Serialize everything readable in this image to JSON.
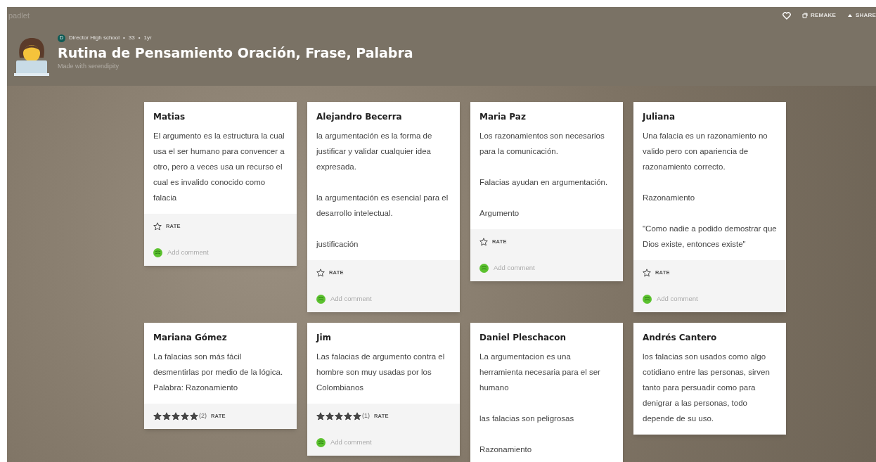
{
  "header": {
    "logo": "padlet",
    "author": {
      "initial": "D",
      "name": "Director High school",
      "separator_1": "•",
      "count": "33",
      "separator_2": "•",
      "age": "1yr"
    },
    "title": "Rutina de Pensamiento Oración, Frase, Palabra",
    "subtitle": "Made with serendipity",
    "actions": [
      "REMAKE",
      "SHARE"
    ]
  },
  "cards": [
    {
      "name": "Matias",
      "paragraphs": [
        "El argumento es la estructura la cual usa el ser humano para convencer a otro, pero a veces usa un recurso el cual es invalido conocido como falacia"
      ],
      "rating": {
        "label": "RATE"
      },
      "comment": "Add comment"
    },
    {
      "name": "Alejandro Becerra",
      "paragraphs": [
        "la argumentación es la forma de justificar y validar cualquier idea expresada.",
        "la argumentación es esencial para el desarrollo intelectual.",
        "justificación"
      ],
      "rating": {
        "label": "RATE"
      },
      "comment": "Add comment"
    },
    {
      "name": "Maria Paz",
      "paragraphs": [
        "Los razonamientos son necesarios para la comunicación.",
        "Falacias ayudan en argumentación.",
        "Argumento"
      ],
      "rating": {
        "label": "RATE"
      },
      "comment": "Add comment"
    },
    {
      "name": "Juliana",
      "paragraphs": [
        "Una falacia es un razonamiento no valido pero con apariencia de razonamiento correcto.",
        "Razonamiento",
        "\"Como nadie a podido demostrar que Dios existe, entonces existe\""
      ],
      "rating": {
        "label": "RATE"
      },
      "comment": "Add comment"
    },
    {
      "name": "Mariana Gómez",
      "paragraphs": [
        "La falacias son más fácil desmentirlas por medio de la lógica.\nPalabra: Razonamiento"
      ],
      "rating": {
        "stars": 5,
        "count": "(2)",
        "label": "RATE"
      }
    },
    {
      "name": "Jim",
      "paragraphs": [
        "Las falacias de argumento contra el hombre son muy usadas por los Colombianos"
      ],
      "rating": {
        "stars": 5,
        "count": "(1)",
        "label": "RATE"
      },
      "comment": "Add comment"
    },
    {
      "name": "Daniel Pleschacon",
      "paragraphs": [
        "La argumentacion es una herramienta necesaria para el ser humano",
        "las falacias son peligrosas",
        "Razonamiento"
      ]
    },
    {
      "name": "Andrés Cantero",
      "paragraphs": [
        "los falacias son usados como algo cotidiano entre las personas, sirven tanto para persuadir como para denigrar a las personas, todo depende de su uso."
      ]
    }
  ]
}
